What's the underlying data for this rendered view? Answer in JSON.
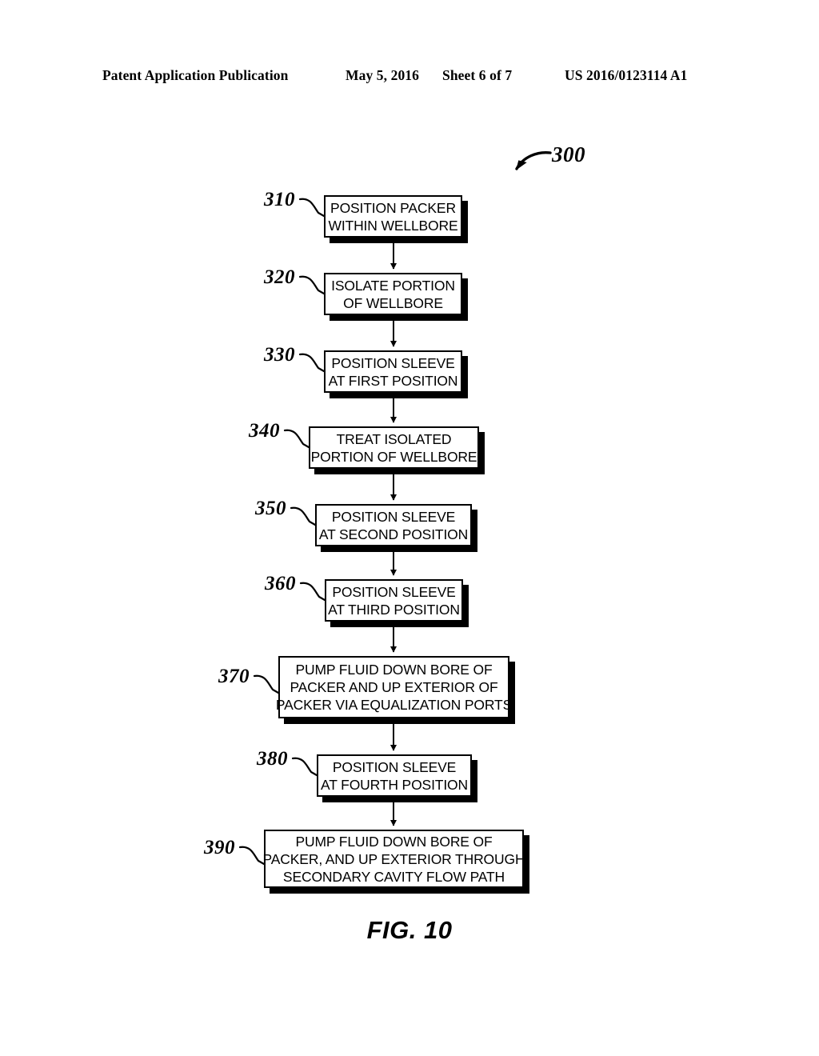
{
  "header": {
    "publication": "Patent Application Publication",
    "date": "May 5, 2016",
    "sheet": "Sheet 6 of 7",
    "patent_number": "US 2016/0123114 A1"
  },
  "figure": {
    "caption": "FIG. 10",
    "diagram_label": "300",
    "line_color": "#000000",
    "background_color": "#ffffff"
  },
  "flowchart": {
    "type": "flowchart",
    "orientation": "vertical",
    "steps": [
      {
        "ref": "310",
        "lines": [
          "POSITION PACKER",
          "WITHIN WELLBORE"
        ],
        "text": "POSITION PACKER WITHIN WELLBORE"
      },
      {
        "ref": "320",
        "lines": [
          "ISOLATE PORTION",
          "OF WELLBORE"
        ],
        "text": "ISOLATE PORTION OF WELLBORE"
      },
      {
        "ref": "330",
        "lines": [
          "POSITION SLEEVE",
          "AT FIRST POSITION"
        ],
        "text": "POSITION SLEEVE AT FIRST POSITION"
      },
      {
        "ref": "340",
        "lines": [
          "TREAT ISOLATED",
          "PORTION OF WELLBORE"
        ],
        "text": "TREAT ISOLATED PORTION OF WELLBORE"
      },
      {
        "ref": "350",
        "lines": [
          "POSITION SLEEVE",
          "AT SECOND POSITION"
        ],
        "text": "POSITION SLEEVE AT SECOND POSITION"
      },
      {
        "ref": "360",
        "lines": [
          "POSITION SLEEVE",
          "AT THIRD POSITION"
        ],
        "text": "POSITION SLEEVE AT THIRD POSITION"
      },
      {
        "ref": "370",
        "lines": [
          "PUMP FLUID DOWN BORE OF",
          "PACKER AND UP EXTERIOR OF",
          "PACKER VIA EQUALIZATION PORTS"
        ],
        "text": "PUMP FLUID DOWN BORE OF PACKER AND UP EXTERIOR OF PACKER VIA EQUALIZATION PORTS"
      },
      {
        "ref": "380",
        "lines": [
          "POSITION SLEEVE",
          "AT FOURTH POSITION"
        ],
        "text": "POSITION SLEEVE AT FOURTH POSITION"
      },
      {
        "ref": "390",
        "lines": [
          "PUMP FLUID DOWN BORE OF",
          "PACKER, AND UP EXTERIOR THROUGH",
          "SECONDARY CAVITY FLOW PATH"
        ],
        "text": "PUMP FLUID DOWN BORE OF PACKER, AND UP EXTERIOR THROUGH SECONDARY CAVITY FLOW PATH"
      }
    ],
    "connectors": 8
  }
}
